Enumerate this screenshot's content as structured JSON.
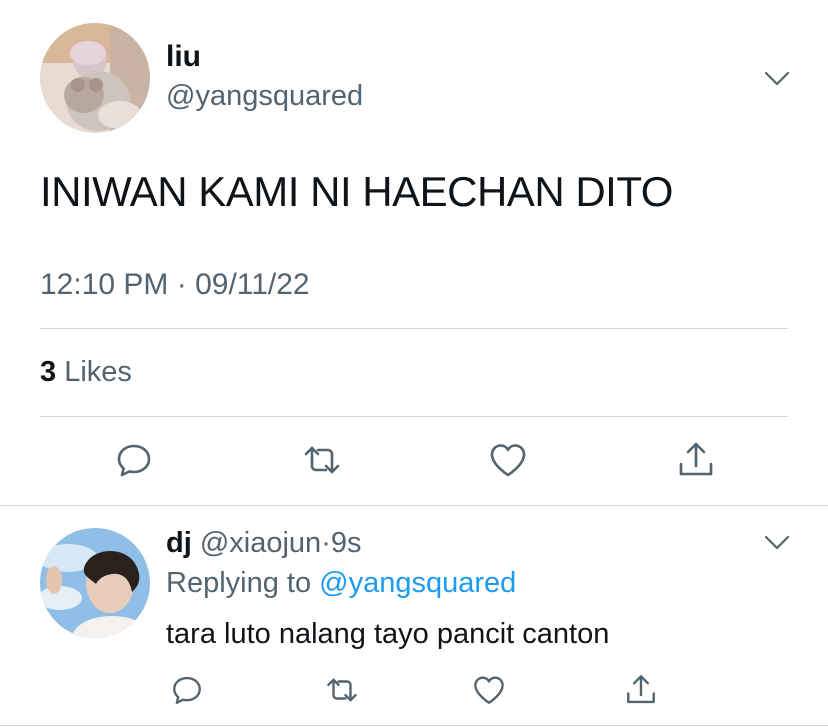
{
  "main_tweet": {
    "display_name": "liu",
    "handle": "@yangsquared",
    "text": "INIWAN KAMI NI HAECHAN DITO",
    "timestamp": "12:10 PM · 09/11/22",
    "likes_count": "3",
    "likes_label": "Likes",
    "actions": [
      "reply-icon",
      "retweet-icon",
      "like-icon",
      "share-icon"
    ]
  },
  "reply_tweet": {
    "display_name": "dj",
    "handle": "@xiaojun",
    "separator": "·",
    "time": "9s",
    "replying_prefix": "Replying to",
    "replying_to": "@yangsquared",
    "text": "tara luto nalang tayo pancit canton",
    "actions": [
      "reply-icon",
      "retweet-icon",
      "like-icon",
      "share-icon"
    ]
  },
  "colors": {
    "text_primary": "#0f1419",
    "text_secondary": "#536471",
    "link": "#1d9bf0",
    "divider": "#cfd9de"
  }
}
